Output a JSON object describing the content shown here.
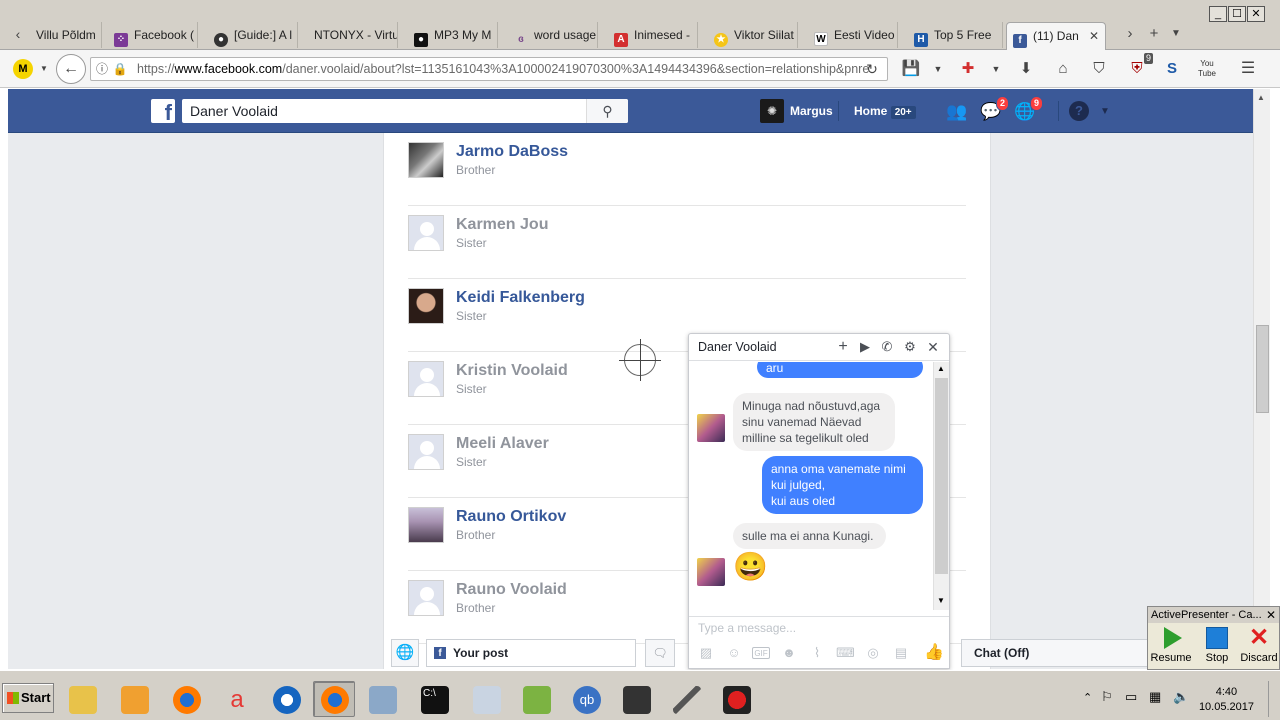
{
  "browser": {
    "tabs": [
      {
        "label": "Villu Põldm",
        "icon": "page-icon",
        "color": "#cfcfcf"
      },
      {
        "label": "Facebook (",
        "icon": "dots-icon",
        "color": "#7b3a96"
      },
      {
        "label": "[Guide:] A l",
        "icon": "github-icon",
        "color": "#333333"
      },
      {
        "label": "NTONYX - Virtu",
        "icon": "none",
        "color": "#ffffff"
      },
      {
        "label": "MP3 My M",
        "icon": "record-icon",
        "color": "#c62828"
      },
      {
        "label": "word usage",
        "icon": "link-icon",
        "color": "#7a4a8c"
      },
      {
        "label": "Inimesed -",
        "icon": "a-icon",
        "color": "#d32f2f"
      },
      {
        "label": "Viktor Siilat",
        "icon": "star-icon",
        "color": "#f5c518"
      },
      {
        "label": "Eesti Video",
        "icon": "wikipedia-icon",
        "color": "#ffffff"
      },
      {
        "label": "Top 5 Free",
        "icon": "h-icon",
        "color": "#1e5aa8"
      },
      {
        "label": "(11) Dan",
        "icon": "facebook-icon",
        "color": "#3b5998"
      }
    ],
    "url_domain": "www.facebook.com",
    "url_prefix": "https://",
    "url_path": "/daner.voolaid/about?lst=1135161043%3A100002419070300%3A1494434396&section=relationship&pnre",
    "ublock_count": "9"
  },
  "facebook": {
    "search_value": "Daner Voolaid",
    "user_name": "Margus",
    "home_label": "Home",
    "home_badge": "20+",
    "messages_badge": "2",
    "notifications_badge": "9",
    "brand_color": "#3b5998"
  },
  "family": [
    {
      "name": "Jarmo DaBoss",
      "relation": "Brother",
      "linked": true,
      "avatar": "photo1"
    },
    {
      "name": "Karmen Jou",
      "relation": "Sister",
      "linked": false,
      "avatar": "blank"
    },
    {
      "name": "Keidi Falkenberg",
      "relation": "Sister",
      "linked": true,
      "avatar": "photo2"
    },
    {
      "name": "Kristin Voolaid",
      "relation": "Sister",
      "linked": false,
      "avatar": "blank"
    },
    {
      "name": "Meeli Alaver",
      "relation": "Sister",
      "linked": false,
      "avatar": "blank"
    },
    {
      "name": "Rauno Ortikov",
      "relation": "Brother",
      "linked": true,
      "avatar": "photo3"
    },
    {
      "name": "Rauno Voolaid",
      "relation": "Brother",
      "linked": false,
      "avatar": "blank"
    }
  ],
  "chat": {
    "title": "Daner Voolaid",
    "messages": [
      {
        "dir": "out",
        "text": "aru"
      },
      {
        "dir": "in",
        "text": "Minuga nad nõustuvd,aga\nsinu vanemad Näevad\nmilline sa tegelikult oled"
      },
      {
        "dir": "out",
        "text": "anna oma vanemate nimi\nkui julged,\nkui aus oled"
      },
      {
        "dir": "in",
        "text": "sulle ma ei anna Kunagi."
      },
      {
        "dir": "in",
        "text": "😀"
      }
    ],
    "input_placeholder": "Type a message...",
    "outgoing_color": "#4080ff"
  },
  "bottombar": {
    "your_post_label": "Your post",
    "chat_status": "Chat (Off)"
  },
  "activepresenter": {
    "title": "ActivePresenter - Ca...",
    "resume_label": "Resume",
    "stop_label": "Stop",
    "discard_label": "Discard"
  },
  "taskbar": {
    "start_label": "Start",
    "time": "4:40",
    "date": "10.05.2017"
  }
}
